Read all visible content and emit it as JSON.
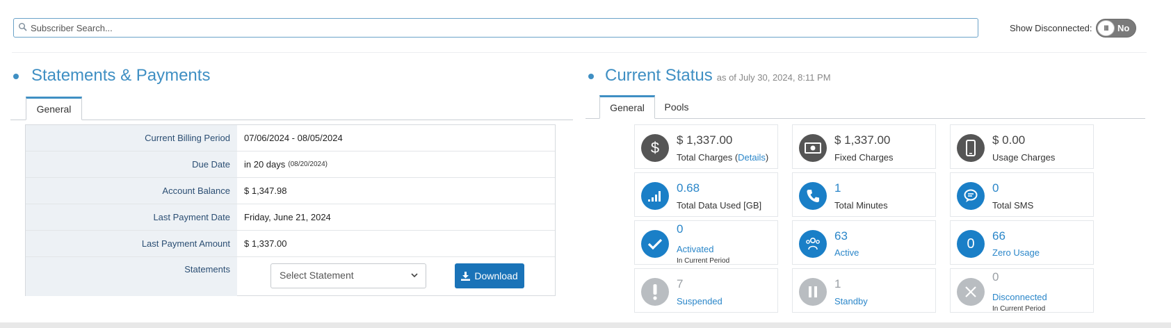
{
  "search": {
    "placeholder": "Subscriber Search..."
  },
  "show_disconnected": {
    "label": "Show Disconnected:",
    "value": "No"
  },
  "statements": {
    "title": "Statements & Payments",
    "tabs": [
      "General"
    ],
    "rows": [
      {
        "label": "Current Billing Period",
        "value": "07/06/2024 - 08/05/2024"
      },
      {
        "label": "Due Date",
        "value": "in 20 days",
        "note": "(08/20/2024)"
      },
      {
        "label": "Account Balance",
        "value": "$ 1,347.98"
      },
      {
        "label": "Last Payment Date",
        "value": "Friday, June 21, 2024"
      },
      {
        "label": "Last Payment Amount",
        "value": "$ 1,337.00"
      }
    ],
    "statements_label": "Statements",
    "select_placeholder": "Select Statement",
    "download_label": "Download"
  },
  "status": {
    "title": "Current Status",
    "as_of": "as of July 30, 2024, 8:11 PM",
    "tabs": [
      "General",
      "Pools"
    ],
    "tiles": [
      {
        "value": "$ 1,337.00",
        "label": "Total Charges",
        "details": "Details",
        "icon": "dollar-icon"
      },
      {
        "value": "$ 1,337.00",
        "label": "Fixed Charges",
        "icon": "cash-icon"
      },
      {
        "value": "$ 0.00",
        "label": "Usage Charges",
        "icon": "phone-device-icon"
      },
      {
        "value": "0.68",
        "label": "Total Data Used [GB]",
        "icon": "signal-icon"
      },
      {
        "value": "1",
        "label": "Total Minutes",
        "icon": "phone-call-icon"
      },
      {
        "value": "0",
        "label": "Total SMS",
        "icon": "chat-icon"
      },
      {
        "value": "0",
        "label": "Activated",
        "sub": "In Current Period",
        "icon": "check-icon"
      },
      {
        "value": "63",
        "label": "Active",
        "icon": "users-icon"
      },
      {
        "value": "66",
        "label": "Zero Usage",
        "icon": "zero-icon",
        "icon_text": "0"
      },
      {
        "value": "7",
        "label": "Suspended",
        "icon": "exclamation-icon"
      },
      {
        "value": "1",
        "label": "Standby",
        "icon": "pause-icon"
      },
      {
        "value": "0",
        "label": "Disconnected",
        "sub": "In Current Period",
        "icon": "close-icon"
      }
    ]
  },
  "colors": {
    "accent": "#3f8fc3",
    "button": "#1a73b8",
    "label": "#2b4e73"
  }
}
